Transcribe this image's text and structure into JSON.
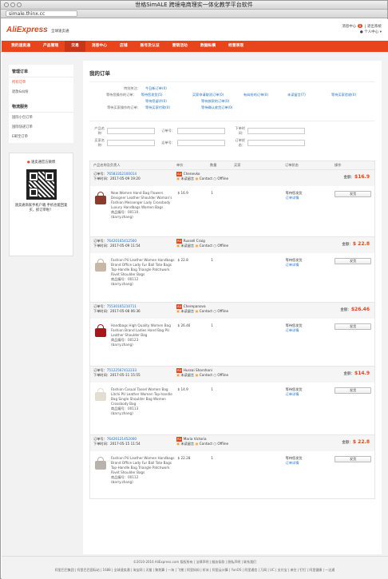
{
  "window": {
    "title": "世格SimALE 跨境电商理实一体化教学平台软件",
    "url": "simale.thinx.cc"
  },
  "header": {
    "logo": "AliExpress",
    "logo_sub": "全球速卖通",
    "msg": "消息中心",
    "msg_count": "0",
    "logout": "退出系统",
    "user": "个人中心"
  },
  "nav": [
    "我的速卖通",
    "产品管理",
    "交易",
    "消息中心",
    "店铺",
    "账号及认证",
    "营销活动",
    "数据纵横",
    "经营表现"
  ],
  "sidebar": {
    "section1": "管理订单",
    "items1": [
      "所有订单",
      "退款&纠纷"
    ],
    "section2": "物流服务",
    "items2": [
      "国际小包订单",
      "国际快递订单",
      "E邮宝订单"
    ],
    "qr_title": "速卖通官方微博",
    "qr_text": "速卖通商家手机户端 手机也能回复买，抓订单啦！"
  },
  "main": {
    "title": "我的订单",
    "info": [
      {
        "label": "特别关注：",
        "v": [
          "今日新订单(0)",
          "",
          "",
          ""
        ]
      },
      {
        "label": "等待您操作的订单：",
        "v": [
          "等待您发货(5)",
          "买家申请取消订单(0)",
          "有纠纷的订单(0)",
          "未读留言(7)"
        ],
        "v2": [
          "等待您留评(0)",
          "",
          "",
          ""
        ]
      },
      {
        "label": "等待买家操作的订单：",
        "v": [
          "等待买家付款(0)",
          "等待确认收货订单(0)",
          "",
          ""
        ]
      }
    ],
    "extra": [
      "等待买家验收(0)",
      "等待放款的订单(0)"
    ],
    "search": [
      "产品名称：",
      "订单号：",
      "下单时间：",
      "",
      "买家名称：",
      "运单号：",
      "订单状态：",
      ""
    ],
    "thead": [
      "产品名称及负责人",
      "单价",
      "数量",
      "买家",
      "订单状态",
      "操作"
    ],
    "orders": [
      {
        "no": "76583352100014",
        "time": "2017-05-09 19:20",
        "flag": "AU",
        "buyer": "Chenevko",
        "total": "$16.9",
        "desc": "New Women Hand Bag Flowers Designer Leather Shoulder Woman's Fashion Messenger Lady Crossbody Luxury Handbags Women Bags",
        "code": "商品编号：00110",
        "owner": "(barry.zhang)",
        "price": "$ 16.9",
        "qty": "1",
        "status": "等待您发货",
        "btn": "发货"
      },
      {
        "no": "76420165412560",
        "time": "2017-05-09 11:54",
        "flag": "RU",
        "buyer": "Russell Craig",
        "total": "$ 22.8",
        "desc": "Fashion PU Leather Women Handbags Brand Office Lady Fur Ball Tote Bags Top-Handle Bag Triangle Patchwork Rivet Shoulder Bags",
        "code": "商品编号：00112",
        "owner": "(barry.zhang)",
        "price": "$ 22.8",
        "qty": "1",
        "status": "等待您发货",
        "btn": "发货"
      },
      {
        "no": "75530165210711",
        "time": "2017-05-08 06:36",
        "flag": "AU",
        "buyer": "Cherepanova",
        "total": "$26.46",
        "desc": "Handbags High Quality Women Bag Fashion Brand Ladies Hand Bag PU Leather Shoulder Bag",
        "code": "商品编号：00123",
        "owner": "(barry.zhang)",
        "price": "$ 26.46",
        "qty": "1",
        "status": "等待您发货",
        "btn": "发货"
      },
      {
        "no": "75122567412233",
        "time": "2017-05-11 15:55",
        "flag": "RU",
        "buyer": "Hussai Sharshani",
        "total": "$14.9",
        "desc": "Fashion Casual Tassel Women Bag Litchi PU Leather Women Top-handle Bag Single Shoulder Bag Women Crossbody Bag",
        "code": "商品编号：00113",
        "owner": "(barry.zhang)",
        "price": "$ 14.9",
        "qty": "1",
        "status": "等待您发货",
        "btn": "发货"
      },
      {
        "no": "76426121452000",
        "time": "2017-05-15 11:54",
        "flag": "RU",
        "buyer": "Maria Victoria",
        "total": "$ 22.8",
        "desc": "Fashion PU Leather Women Handbags Brand Office Lady Fur Ball Tote Bags Top-Handle Bag Triangle Patchwork Rivet Shoulder Bags",
        "code": "商品编号：00112",
        "owner": "(barry.zhang)",
        "price": "$ 22.28",
        "qty": "1",
        "status": "等待您发货",
        "btn": "发货"
      }
    ],
    "labels": {
      "order_no": "订单号：",
      "order_time": "下单时间：",
      "total": "金额：",
      "unread": "未读留言",
      "contact": "Contact",
      "offline": "Offline",
      "detail": "订单详情"
    }
  },
  "footer": {
    "line1": "©2010-2016 AliExpress.com 版权所有 | 法律声明 | 服务条款 | 隐私声明 | 联系我们",
    "line2": "阿里巴巴集团 | 阿里巴巴国际站 | 1688 | 全球速卖通 | 淘宝网 | 天猫 | 聚划算 | 一淘 | 飞猪 | 阿里妈妈 | 虾米 | 阿里云计算 | YunOS | 阿里通信 | 万网 | UC | 支付宝 | 来往 | 钉钉 | 阿里健康 | 一达通"
  }
}
